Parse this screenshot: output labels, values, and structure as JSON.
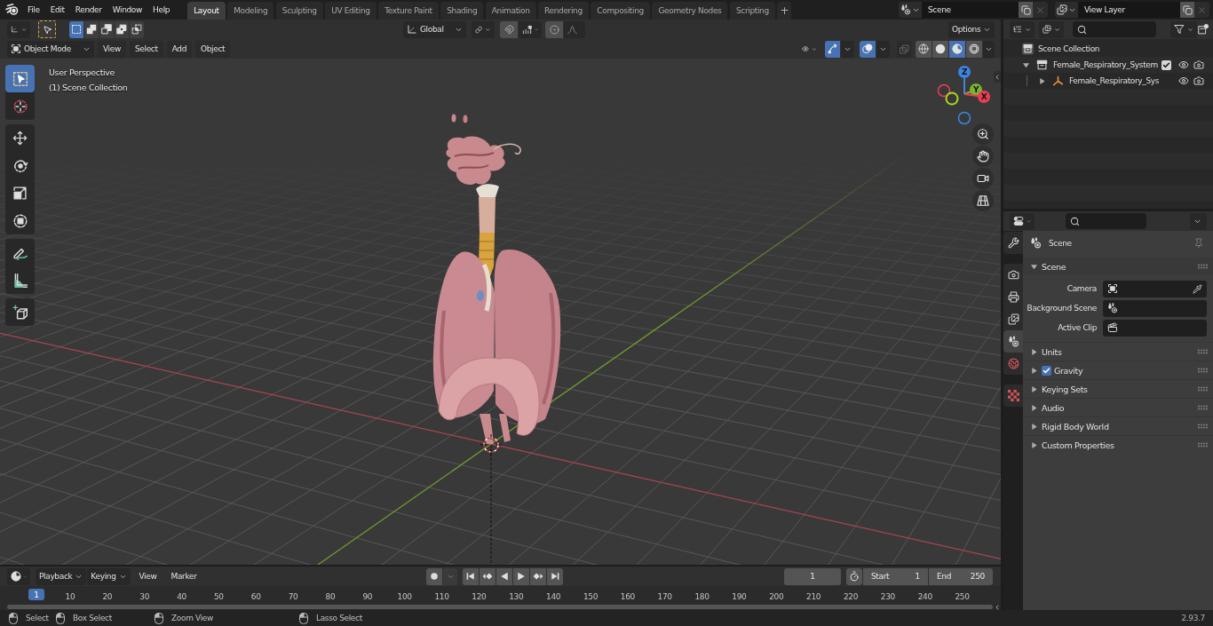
{
  "topbar": {
    "menus": [
      "File",
      "Edit",
      "Render",
      "Window",
      "Help"
    ],
    "workspaces": [
      {
        "label": "Layout",
        "selected": true
      },
      {
        "label": "Modeling",
        "selected": false
      },
      {
        "label": "Sculpting",
        "selected": false
      },
      {
        "label": "UV Editing",
        "selected": false
      },
      {
        "label": "Texture Paint",
        "selected": false
      },
      {
        "label": "Shading",
        "selected": false
      },
      {
        "label": "Animation",
        "selected": false
      },
      {
        "label": "Rendering",
        "selected": false
      },
      {
        "label": "Compositing",
        "selected": false
      },
      {
        "label": "Geometry Nodes",
        "selected": false
      },
      {
        "label": "Scripting",
        "selected": false
      }
    ],
    "add_workspace": "+",
    "scene": "Scene",
    "view_layer": "View Layer"
  },
  "tool_header": {
    "select_modes": [
      {
        "selected": true
      },
      {
        "selected": false
      },
      {
        "selected": false
      },
      {
        "selected": false
      },
      {
        "selected": false
      }
    ],
    "orientation": "Global",
    "options": "Options"
  },
  "viewport_header": {
    "mode": "Object Mode",
    "menus": [
      "View",
      "Select",
      "Add",
      "Object"
    ],
    "gizmos_on": true,
    "overlays_on": true,
    "xray_on": false,
    "shading_modes": [
      {
        "kind": "wireframe",
        "selected": false
      },
      {
        "kind": "solid",
        "selected": false
      },
      {
        "kind": "material",
        "selected": true
      },
      {
        "kind": "rendered",
        "selected": false
      }
    ]
  },
  "toolbar": {
    "groups": [
      [
        {
          "kind": "select",
          "selected": true
        },
        {
          "kind": "cursor",
          "selected": false
        }
      ],
      [
        {
          "kind": "move",
          "selected": false
        },
        {
          "kind": "rotate",
          "selected": false
        },
        {
          "kind": "scale",
          "selected": false
        },
        {
          "kind": "transform",
          "selected": false
        }
      ],
      [
        {
          "kind": "annotate",
          "selected": false
        },
        {
          "kind": "measure",
          "selected": false
        }
      ],
      [
        {
          "kind": "add_cube",
          "selected": false
        }
      ]
    ]
  },
  "viewport": {
    "view_name": "User Perspective",
    "collection": "(1) Scene Collection",
    "gizmo_axes": [
      {
        "kind": "z",
        "label": "Z"
      },
      {
        "kind": "y",
        "label": "Y"
      },
      {
        "kind": "x",
        "label": "X"
      }
    ]
  },
  "outliner": {
    "root": "Scene Collection",
    "items": [
      {
        "label": "Female_Respiratory_System",
        "kind": "collection",
        "expanded": true,
        "checked": true,
        "children": [
          {
            "label": "Female_Respiratory_Sys",
            "kind": "empty",
            "expanded": false
          }
        ]
      }
    ]
  },
  "properties": {
    "tabs": [
      [
        {
          "kind": "tool",
          "selected": false
        }
      ],
      [
        {
          "kind": "render",
          "selected": false
        },
        {
          "kind": "output",
          "selected": false
        },
        {
          "kind": "view_layer",
          "selected": false
        },
        {
          "kind": "scene",
          "selected": true
        },
        {
          "kind": "world",
          "selected": false
        }
      ],
      [
        {
          "kind": "texture",
          "selected": false
        }
      ]
    ],
    "context": "Scene",
    "panel": {
      "title": "Scene",
      "expanded": true,
      "fields": [
        {
          "label": "Camera",
          "kind": "camera"
        },
        {
          "label": "Background Scene",
          "kind": "scene"
        },
        {
          "label": "Active Clip",
          "kind": "clip"
        }
      ]
    },
    "subpanels": [
      {
        "label": "Units",
        "kind": "plain",
        "expanded": false
      },
      {
        "label": "Gravity",
        "kind": "checkbox",
        "checked": true,
        "expanded": false
      },
      {
        "label": "Keying Sets",
        "kind": "plain",
        "expanded": false
      },
      {
        "label": "Audio",
        "kind": "plain",
        "expanded": false
      },
      {
        "label": "Rigid Body World",
        "kind": "plain",
        "expanded": false
      },
      {
        "label": "Custom Properties",
        "kind": "plain",
        "expanded": false
      }
    ]
  },
  "timeline": {
    "menus": [
      {
        "label": "Playback",
        "kind": "dropdown"
      },
      {
        "label": "Keying",
        "kind": "dropdown"
      },
      {
        "label": "View",
        "kind": "menu"
      },
      {
        "label": "Marker",
        "kind": "menu"
      }
    ],
    "current_frame": "1",
    "start_label": "Start",
    "start": "1",
    "end_label": "End",
    "end": "250",
    "frame_indicator": "1",
    "ruler": [
      "10",
      "20",
      "30",
      "40",
      "50",
      "60",
      "70",
      "80",
      "90",
      "100",
      "110",
      "120",
      "130",
      "140",
      "150",
      "160",
      "170",
      "180",
      "190",
      "200",
      "210",
      "220",
      "230",
      "240",
      "250"
    ]
  },
  "status_bar": {
    "hints": [
      "Select",
      "Box Select",
      "Zoom View",
      "Lasso Select"
    ],
    "version": "2.93.7"
  }
}
